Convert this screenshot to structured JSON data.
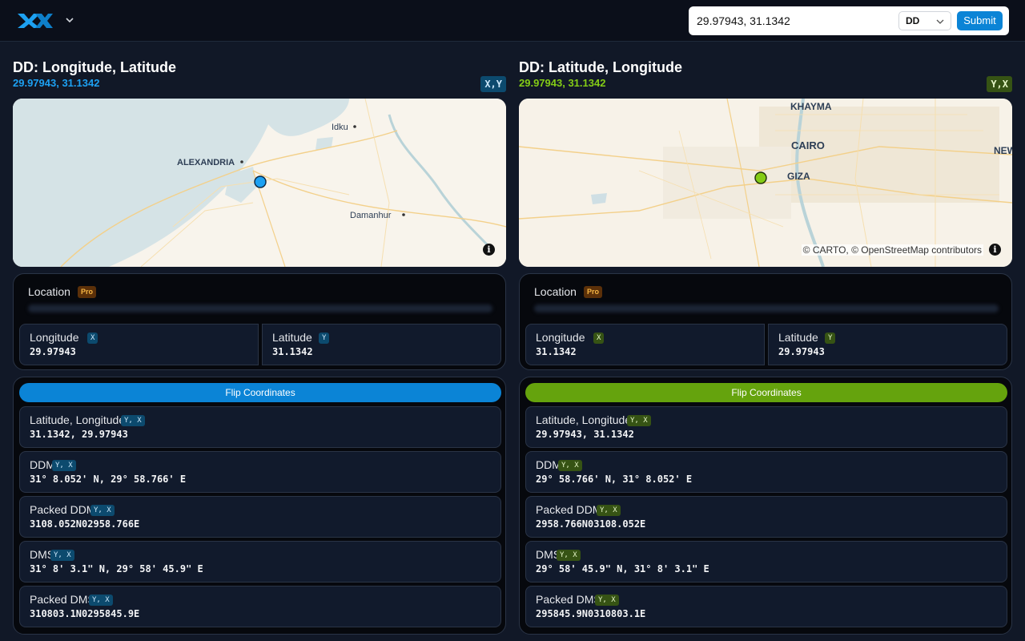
{
  "header": {
    "search_value": "29.97943, 31.1342",
    "format_selected": "DD",
    "submit_label": "Submit"
  },
  "colors": {
    "accent_blue": "#0b84d6",
    "accent_green": "#65a30d",
    "background": "#111827"
  },
  "left": {
    "title": "DD: Longitude, Latitude",
    "subtitle": "29.97943, 31.1342",
    "order_badge": "X,Y",
    "map": {
      "labels": [
        "Idku",
        "ALEXANDRIA",
        "Damanhur"
      ],
      "info": "i"
    },
    "location_label": "Location",
    "pro_badge": "Pro",
    "coords": [
      {
        "label": "Longitude",
        "badge": "X",
        "value": "29.97943"
      },
      {
        "label": "Latitude",
        "badge": "Y",
        "value": "31.1342"
      }
    ],
    "flip_label": "Flip Coordinates",
    "formats": [
      {
        "label": "Latitude, Longitude",
        "badge": "Y, X",
        "value": "31.1342, 29.97943"
      },
      {
        "label": "DDM",
        "badge": "Y, X",
        "value": "31° 8.052' N, 29° 58.766' E"
      },
      {
        "label": "Packed DDM",
        "badge": "Y, X",
        "value": "3108.052N02958.766E"
      },
      {
        "label": "DMS",
        "badge": "Y, X",
        "value": "31° 8' 3.1\" N, 29° 58' 45.9\" E"
      },
      {
        "label": "Packed DMS",
        "badge": "Y, X",
        "value": "310803.1N0295845.9E"
      }
    ]
  },
  "right": {
    "title": "DD: Latitude, Longitude",
    "subtitle": "29.97943, 31.1342",
    "order_badge": "Y,X",
    "map": {
      "labels": [
        "KHAYMA",
        "CAIRO",
        "GIZA",
        "NEW"
      ],
      "attribution": "© CARTO, © OpenStreetMap contributors",
      "info": "i"
    },
    "location_label": "Location",
    "pro_badge": "Pro",
    "coords": [
      {
        "label": "Longitude",
        "badge": "X",
        "value": "31.1342"
      },
      {
        "label": "Latitude",
        "badge": "Y",
        "value": "29.97943"
      }
    ],
    "flip_label": "Flip Coordinates",
    "formats": [
      {
        "label": "Latitude, Longitude",
        "badge": "Y, X",
        "value": "29.97943, 31.1342"
      },
      {
        "label": "DDM",
        "badge": "Y, X",
        "value": "29° 58.766' N, 31° 8.052' E"
      },
      {
        "label": "Packed DDM",
        "badge": "Y, X",
        "value": "2958.766N03108.052E"
      },
      {
        "label": "DMS",
        "badge": "Y, X",
        "value": "29° 58' 45.9\" N, 31° 8' 3.1\" E"
      },
      {
        "label": "Packed DMS",
        "badge": "Y, X",
        "value": "295845.9N0310803.1E"
      }
    ]
  }
}
